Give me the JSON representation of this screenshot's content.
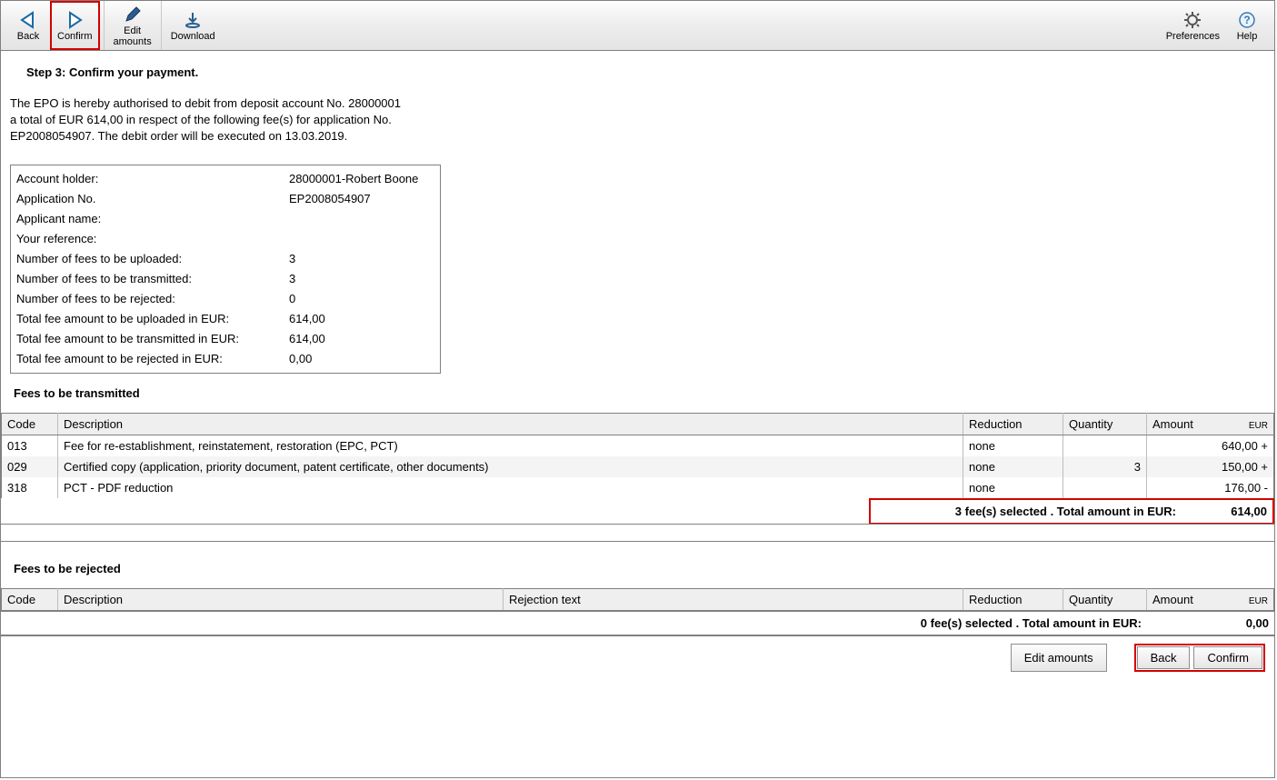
{
  "toolbar": {
    "back": "Back",
    "confirm": "Confirm",
    "edit_amounts": "Edit\namounts",
    "download": "Download",
    "preferences": "Preferences",
    "help": "Help"
  },
  "step_title": "Step 3: Confirm your payment.",
  "auth_text": "The EPO is hereby authorised to debit from deposit account No. 28000001\na total of EUR 614,00 in respect of the following fee(s) for application No.\nEP2008054907. The debit order will be executed on 13.03.2019.",
  "details": {
    "account_holder_k": "Account holder:",
    "account_holder_v": "28000001-Robert Boone",
    "application_no_k": "Application No.",
    "application_no_v": "EP2008054907",
    "applicant_name_k": "Applicant name:",
    "applicant_name_v": "",
    "your_reference_k": "Your reference:",
    "your_reference_v": "",
    "fees_upload_k": "Number of fees to be uploaded:",
    "fees_upload_v": "3",
    "fees_transmit_k": "Number of fees to be transmitted:",
    "fees_transmit_v": "3",
    "fees_reject_k": "Number of fees to be rejected:",
    "fees_reject_v": "0",
    "total_upload_k": "Total fee amount to be uploaded in EUR:",
    "total_upload_v": "614,00",
    "total_transmit_k": "Total fee amount to be transmitted in EUR:",
    "total_transmit_v": "614,00",
    "total_reject_k": "Total fee amount to be rejected in EUR:",
    "total_reject_v": "0,00"
  },
  "transmit": {
    "title": "Fees to be transmitted",
    "headers": {
      "code": "Code",
      "desc": "Description",
      "reduction": "Reduction",
      "qty": "Quantity",
      "amount": "Amount",
      "eur": "EUR"
    },
    "rows": [
      {
        "code": "013",
        "desc": "Fee for re-establishment, reinstatement, restoration (EPC, PCT)",
        "reduction": "none",
        "qty": "",
        "amount": "640,00 +"
      },
      {
        "code": "029",
        "desc": "Certified copy (application, priority document, patent certificate, other documents)",
        "reduction": "none",
        "qty": "3",
        "amount": "150,00 +"
      },
      {
        "code": "318",
        "desc": "PCT - PDF reduction",
        "reduction": "none",
        "qty": "",
        "amount": "176,00 -"
      }
    ],
    "total_label": "3 fee(s) selected . Total amount in EUR:",
    "total_value": "614,00"
  },
  "reject": {
    "title": "Fees to be rejected",
    "headers": {
      "code": "Code",
      "desc": "Description",
      "rejtext": "Rejection text",
      "reduction": "Reduction",
      "qty": "Quantity",
      "amount": "Amount",
      "eur": "EUR"
    },
    "total_label": "0 fee(s) selected . Total amount in EUR:",
    "total_value": "0,00"
  },
  "footer": {
    "edit_amounts": "Edit amounts",
    "back": "Back",
    "confirm": "Confirm"
  }
}
